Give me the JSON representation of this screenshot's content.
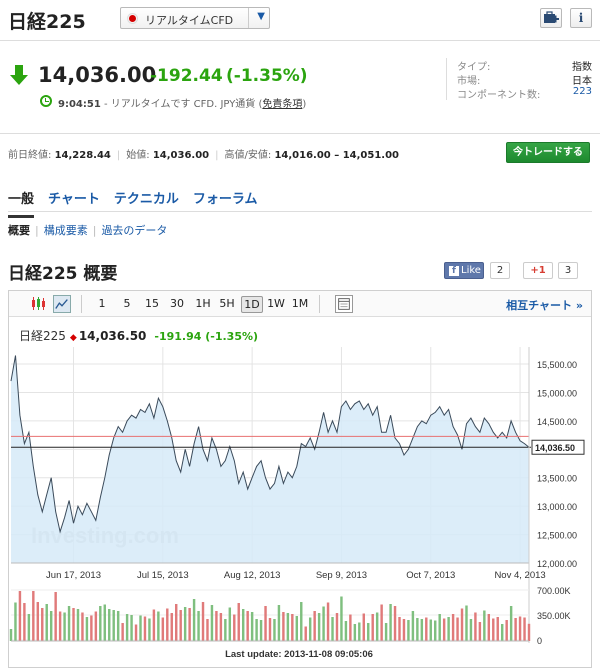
{
  "header": {
    "title": "日経225",
    "select_label": "リアルタイムCFD",
    "portfolio_icon": "portfolio-add-icon",
    "info_icon": "info-icon"
  },
  "quote": {
    "price": "14,036.00",
    "change": "-192.44",
    "change_pct": "(-1.35%)",
    "time": "9:04:51",
    "time_note": "- リアルタイムです CFD. JPY通貨 (",
    "disclaimer": "免責条項",
    "time_close": ")"
  },
  "info": [
    {
      "key": "タイプ:",
      "value": "指数"
    },
    {
      "key": "市場:",
      "value": "日本"
    },
    {
      "key": "コンポーネント数:",
      "value": "223"
    }
  ],
  "stats": {
    "prev_label": "前日終値:",
    "prev": "14,228.44",
    "open_label": "始値:",
    "open": "14,036.00",
    "range_label": "高値/安値:",
    "range": "14,016.00 – 14,051.00"
  },
  "trade_button": "今トレードする",
  "tabs": [
    "一般",
    "チャート",
    "テクニカル",
    "フォーラム"
  ],
  "subtabs": [
    "概要",
    "構成要素",
    "過去のデータ"
  ],
  "section_title": "日経225 概要",
  "social": {
    "fb_label": "Like",
    "fb_count": "2",
    "gplus_label": "+1",
    "gplus_count": "3"
  },
  "chart_toolbar": {
    "periods": [
      "1",
      "5",
      "15",
      "30",
      "1H",
      "5H",
      "1D",
      "1W",
      "1M"
    ],
    "active_period": "1D",
    "compare": "相互チャート »"
  },
  "chart_legend": {
    "name": "日経225",
    "price": "14,036.50",
    "change": "-191.94 (-1.35%)"
  },
  "chart_data": {
    "type": "area",
    "title": "",
    "price_ticks": [
      15500,
      15000,
      14500,
      14000,
      13500,
      13000,
      12500,
      12000
    ],
    "price_tick_labels": [
      "15,500.00",
      "15,000.00",
      "14,500.00",
      "14,000.00",
      "13,500.00",
      "13,000.00",
      "12,500.00",
      "12,000.00"
    ],
    "ylim": [
      12000,
      15800
    ],
    "current_label": "14,036.50",
    "current": 14036.5,
    "prev_close": 14228.44,
    "x_labels": [
      "Jun 17, 2013",
      "Jul 15, 2013",
      "Aug 12, 2013",
      "Sep 9, 2013",
      "Oct 7, 2013",
      "Nov 4, 2013"
    ],
    "x_label_index": [
      14,
      34,
      54,
      74,
      94,
      114
    ],
    "values": [
      15200,
      15650,
      14600,
      14100,
      14300,
      13700,
      13200,
      12900,
      13200,
      13500,
      12900,
      12550,
      12800,
      13100,
      12700,
      13000,
      12850,
      13050,
      12900,
      12750,
      13150,
      13500,
      13900,
      14200,
      14400,
      14300,
      14500,
      14600,
      14550,
      14700,
      14650,
      14800,
      14550,
      14900,
      14750,
      14500,
      14200,
      13800,
      13600,
      14000,
      13700,
      14100,
      14400,
      14000,
      13800,
      14200,
      14000,
      13700,
      13800,
      14050,
      13800,
      13400,
      13600,
      13300,
      13500,
      13700,
      13800,
      13500,
      13300,
      13400,
      13700,
      13400,
      13600,
      13500,
      13700,
      14100,
      14050,
      14200,
      14000,
      14300,
      14650,
      14300,
      14500,
      14300,
      14750,
      14850,
      14700,
      14800,
      14850,
      14700,
      14800,
      14600,
      14750,
      14300,
      14300,
      14600,
      14200,
      14100,
      13900,
      14000,
      14200,
      14400,
      14500,
      14450,
      14600,
      14650,
      14750,
      14600,
      14700,
      14400,
      14250,
      14000,
      14450,
      14550,
      14400,
      14300,
      14550,
      14450,
      14300,
      14200,
      14300,
      14200,
      14500,
      14300,
      14150,
      14100,
      14036
    ],
    "volume_ticks": [
      "700.00K",
      "350.00K",
      "0"
    ],
    "volume_max": 700000,
    "last_update": "Last update: 2013-11-08 09:05:06",
    "watermark": "Investing.com"
  }
}
